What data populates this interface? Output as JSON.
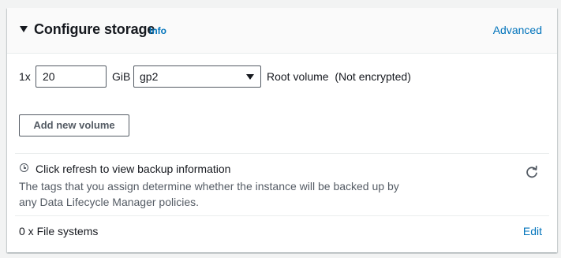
{
  "header": {
    "title": "Configure storage",
    "info_label": "Info",
    "advanced_label": "Advanced"
  },
  "volume": {
    "count_prefix": "1x",
    "size_value": "20",
    "size_unit": "GiB",
    "volume_type": "gp2",
    "description": "Root volume  (Not encrypted)"
  },
  "add_volume_button": "Add new volume",
  "backup": {
    "title": "Click refresh to view backup information",
    "description": "The tags that you assign determine whether the instance will be backed up by any Data Lifecycle Manager policies."
  },
  "file_systems": {
    "label": "0 x File systems",
    "edit_label": "Edit"
  },
  "colors": {
    "link": "#0073bb",
    "text": "#16191f",
    "secondary_text": "#545b64"
  },
  "icons": {
    "caret": "caret-down-icon",
    "clock": "clock-icon",
    "refresh": "refresh-icon"
  }
}
